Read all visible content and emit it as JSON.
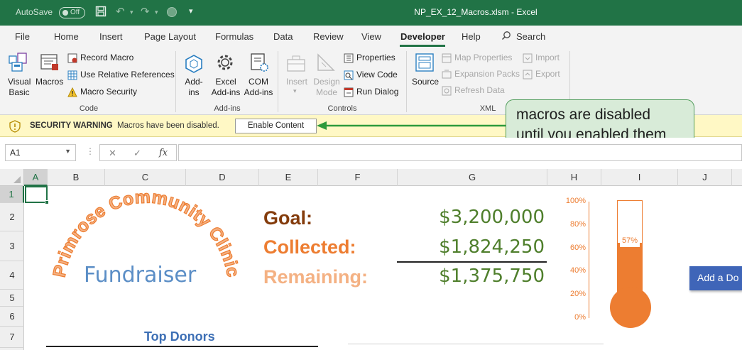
{
  "titlebar": {
    "autosave_label": "AutoSave",
    "autosave_state": "Off",
    "document_title": "NP_EX_12_Macros.xlsm  -  Excel"
  },
  "tabs": [
    "File",
    "Home",
    "Insert",
    "Page Layout",
    "Formulas",
    "Data",
    "Review",
    "View",
    "Developer",
    "Help"
  ],
  "active_tab": "Developer",
  "search_label": "Search",
  "ribbon": {
    "code": {
      "visual_basic": "Visual\nBasic",
      "visual_basic_line1": "Visual",
      "visual_basic_line2": "Basic",
      "macros": "Macros",
      "record_macro": "Record Macro",
      "relative_refs": "Use Relative References",
      "macro_security": "Macro Security",
      "label": "Code"
    },
    "addins": {
      "addins_line1": "Add-",
      "addins_line2": "ins",
      "excel_addins_line1": "Excel",
      "excel_addins_line2": "Add-ins",
      "com_addins_line1": "COM",
      "com_addins_line2": "Add-ins",
      "label": "Add-ins"
    },
    "controls": {
      "insert": "Insert",
      "design_mode_line1": "Design",
      "design_mode_line2": "Mode",
      "properties": "Properties",
      "view_code": "View Code",
      "run_dialog": "Run Dialog",
      "label": "Controls"
    },
    "xml": {
      "source": "Source",
      "map_properties": "Map Properties",
      "expansion_packs": "Expansion Packs",
      "refresh_data": "Refresh Data",
      "import": "Import",
      "export": "Export",
      "label": "XML"
    }
  },
  "security_bar": {
    "title": "SECURITY WARNING",
    "message": "Macros have been disabled.",
    "button": "Enable Content"
  },
  "callout": {
    "line1": "macros are disabled",
    "line2": "until you enabled them"
  },
  "formula_bar": {
    "name_box": "A1",
    "fx": "fx",
    "value": ""
  },
  "columns": [
    "A",
    "B",
    "C",
    "D",
    "E",
    "F",
    "G",
    "H",
    "I",
    "J"
  ],
  "selected_column": "A",
  "rows": [
    "1",
    "2",
    "3",
    "4",
    "5",
    "6",
    "7"
  ],
  "selected_row": "1",
  "sheet": {
    "arc_text": "Primrose Community Clinic",
    "subtitle": "Fundraiser",
    "goal_label": "Goal:",
    "collected_label": "Collected:",
    "remaining_label": "Remaining:",
    "goal_value": "$3,200,000",
    "collected_value": "$1,824,250",
    "remaining_value": "$1,375,750",
    "top_donors": "Top Donors",
    "add_donor_button": "Add a Do",
    "thermometer": {
      "percent_label": "57%",
      "fraction": 0.57,
      "axis_ticks": [
        "100%",
        "80%",
        "60%",
        "40%",
        "20%",
        "0%"
      ],
      "fill_color": "#ed7d31"
    }
  },
  "colors": {
    "excel_green": "#217346",
    "goal_color": "#843c0c",
    "collected_color": "#ed7d31",
    "remaining_color": "#f4b183",
    "money_color": "#4f7f2c"
  }
}
